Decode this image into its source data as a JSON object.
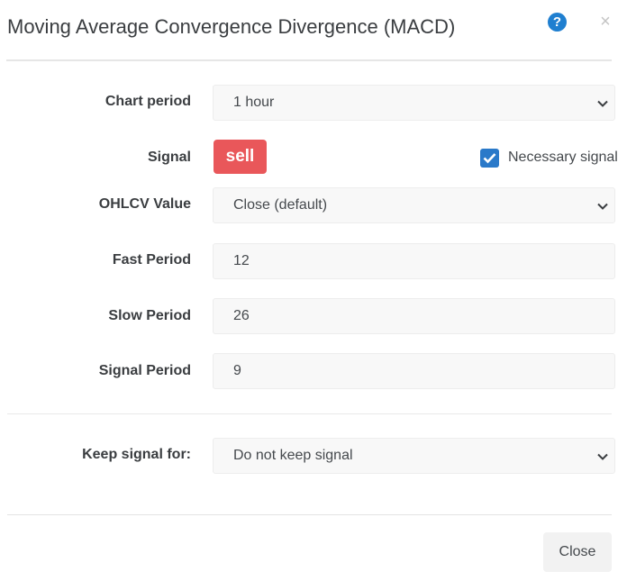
{
  "header": {
    "title": "Moving Average Convergence Divergence (MACD)",
    "help_icon": "question-circle-icon",
    "help_glyph": "?",
    "close_icon": "close-icon",
    "close_glyph": "×"
  },
  "form": {
    "chart_period": {
      "label": "Chart period",
      "value": "1 hour"
    },
    "signal": {
      "label": "Signal",
      "value": "sell",
      "badge_color": "#e9575a",
      "necessary_label": "Necessary signal",
      "necessary_checked": true
    },
    "ohlcv": {
      "label": "OHLCV Value",
      "value": "Close (default)"
    },
    "fast_period": {
      "label": "Fast Period",
      "value": "12"
    },
    "slow_period": {
      "label": "Slow Period",
      "value": "26"
    },
    "signal_period": {
      "label": "Signal Period",
      "value": "9"
    },
    "keep_signal": {
      "label": "Keep signal for:",
      "value": "Do not keep signal"
    }
  },
  "footer": {
    "close_label": "Close"
  },
  "colors": {
    "accent": "#1f7fd0",
    "checkbox": "#2a79c9",
    "sell": "#e9575a"
  }
}
